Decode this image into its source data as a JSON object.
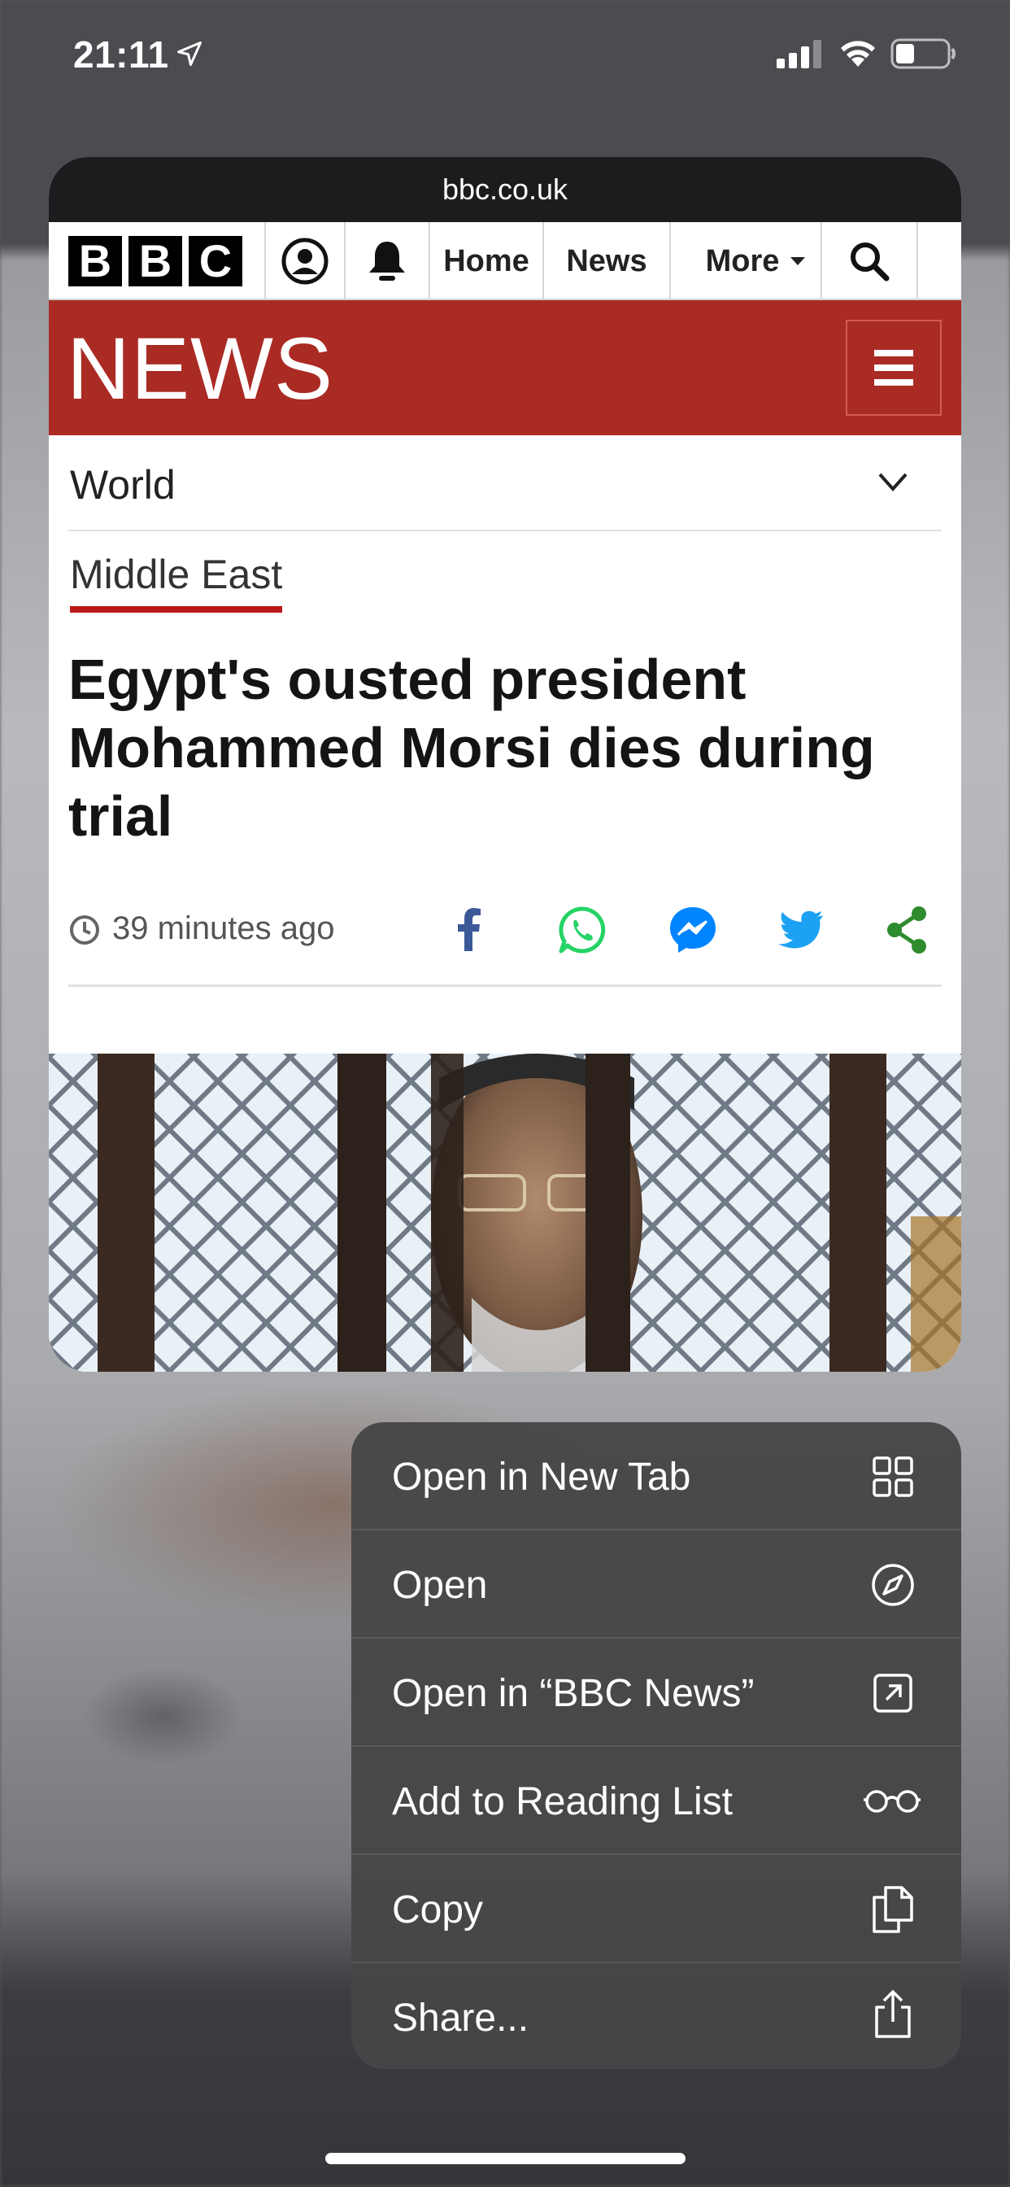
{
  "status_bar": {
    "time": "21:11"
  },
  "preview": {
    "url": "bbc.co.uk",
    "nav": {
      "logo_letters": [
        "B",
        "B",
        "C"
      ],
      "home": "Home",
      "news": "News",
      "more": "More"
    },
    "brand": "NEWS",
    "section": "World",
    "sub_section": "Middle East",
    "headline": "Egypt's ousted president Mohammed Morsi dies during trial",
    "time_ago": "39 minutes ago",
    "share_colors": {
      "facebook": "#3b5998",
      "whatsapp": "#25d366",
      "messenger": "#0084ff",
      "twitter": "#1da1f2",
      "share": "#2e8b2e"
    }
  },
  "context_menu": {
    "items": [
      {
        "label": "Open in New Tab",
        "icon": "grid-icon"
      },
      {
        "label": "Open",
        "icon": "compass-icon"
      },
      {
        "label": "Open in “BBC News”",
        "icon": "open-external-icon"
      },
      {
        "label": "Add to Reading List",
        "icon": "glasses-icon"
      },
      {
        "label": "Copy",
        "icon": "copy-icon"
      },
      {
        "label": "Share...",
        "icon": "share-icon"
      }
    ]
  },
  "colors": {
    "news_red": "#aa2a24",
    "underline_red": "#bb1919",
    "menu_bg": "#464648"
  }
}
